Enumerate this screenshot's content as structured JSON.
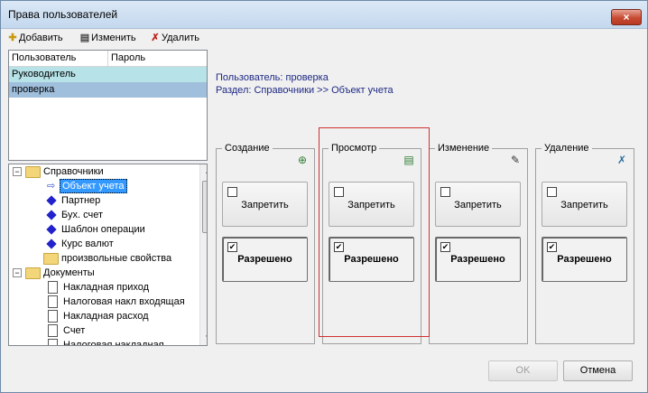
{
  "window": {
    "title": "Права пользователей",
    "close_icon": "×"
  },
  "toolbar": {
    "add_label": "Добавить",
    "edit_label": "Изменить",
    "delete_label": "Удалить"
  },
  "users_grid": {
    "columns": [
      "Пользователь",
      "Пароль"
    ],
    "rows": [
      {
        "user": "Руководитель",
        "password": ""
      },
      {
        "user": "проверка",
        "password": ""
      }
    ]
  },
  "info": {
    "user_label": "Пользователь:",
    "user_value": "проверка",
    "section_label": "Раздел:",
    "section_value": "Справочники >> Объект учета"
  },
  "tree": [
    {
      "label": "Справочники",
      "expander": "−"
    },
    {
      "label": "Объект учета"
    },
    {
      "label": "Партнер"
    },
    {
      "label": "Бух. счет"
    },
    {
      "label": "Шаблон операции"
    },
    {
      "label": "Курс валют"
    },
    {
      "label": "произвольные свойства"
    },
    {
      "label": "Документы",
      "expander": "−"
    },
    {
      "label": "Накладная приход"
    },
    {
      "label": "Налоговая накл входящая"
    },
    {
      "label": "Накладная расход"
    },
    {
      "label": "Счет"
    },
    {
      "label": "Налоговая накладная"
    }
  ],
  "permissions": [
    {
      "title": "Создание",
      "deny_label": "Запретить",
      "deny_checked": "",
      "allow_label": "Разрешено",
      "allow_checked": "✔"
    },
    {
      "title": "Просмотр",
      "deny_label": "Запретить",
      "deny_checked": "",
      "allow_label": "Разрешено",
      "allow_checked": "✔"
    },
    {
      "title": "Изменение",
      "deny_label": "Запретить",
      "deny_checked": "",
      "allow_label": "Разрешено",
      "allow_checked": "✔"
    },
    {
      "title": "Удаление",
      "deny_label": "Запретить",
      "deny_checked": "",
      "allow_label": "Разрешено",
      "allow_checked": "✔"
    }
  ],
  "footer": {
    "ok_label": "OK",
    "cancel_label": "Отмена"
  },
  "colors": {
    "selected_row": "#9fbfdc",
    "first_row": "#b7e3e8",
    "highlight_border": "#d03030"
  }
}
